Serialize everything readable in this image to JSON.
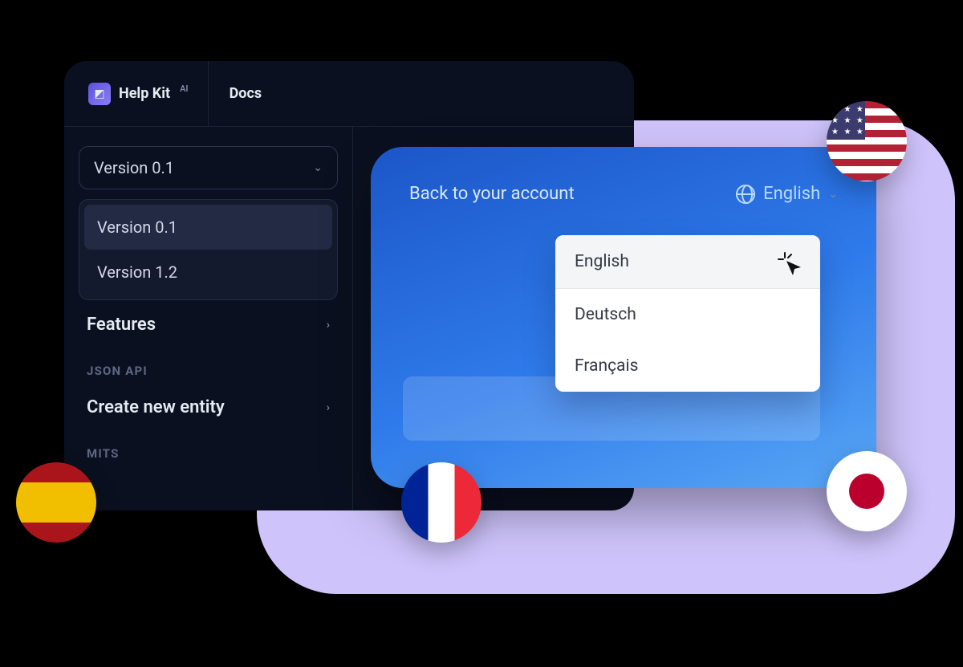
{
  "brand": {
    "name": "Help Kit",
    "sup": "AI"
  },
  "header": {
    "docs": "Docs"
  },
  "sidebar": {
    "version_selected": "Version 0.1",
    "versions": [
      "Version 0.1",
      "Version 1.2"
    ],
    "features": "Features",
    "section_json_api": "JSON API",
    "create_entity": "Create new entity",
    "section_limits": "MITS"
  },
  "lang_panel": {
    "back": "Back to your account",
    "current": "English",
    "options": [
      "English",
      "Deutsch",
      "Français"
    ]
  },
  "flags": {
    "us": "United States",
    "es": "Spain",
    "fr": "France",
    "jp": "Japan"
  }
}
